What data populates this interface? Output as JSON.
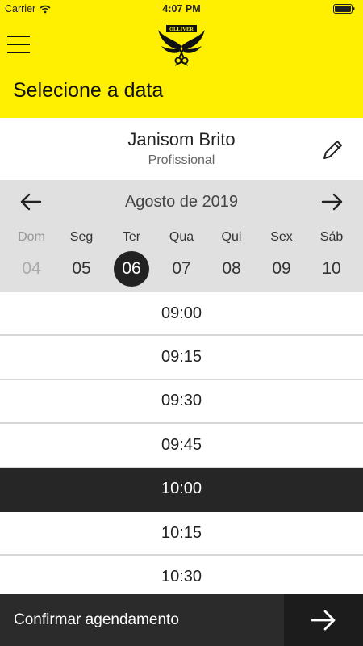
{
  "status_bar": {
    "carrier": "Carrier",
    "time": "4:07 PM"
  },
  "header": {
    "title": "Selecione a data",
    "logo_text": "OLLIVER"
  },
  "professional": {
    "name": "Janisom Brito",
    "role": "Profissional"
  },
  "calendar": {
    "month_label": "Agosto de 2019",
    "weekdays": [
      "Dom",
      "Seg",
      "Ter",
      "Qua",
      "Qui",
      "Sex",
      "Sáb"
    ],
    "days": [
      "04",
      "05",
      "06",
      "07",
      "08",
      "09",
      "10"
    ],
    "selected_day": "06"
  },
  "time_slots": [
    "09:00",
    "09:15",
    "09:30",
    "09:45",
    "10:00",
    "10:15",
    "10:30"
  ],
  "selected_time": "10:00",
  "footer": {
    "confirm_label": "Confirmar agendamento"
  },
  "colors": {
    "accent": "#ffef00",
    "dark": "#262626",
    "calendar_bg": "#e0e0e0"
  },
  "icons": [
    "wifi-icon",
    "battery-icon",
    "menu-icon",
    "logo-icon",
    "edit-pencil-icon",
    "arrow-left-icon",
    "arrow-right-icon",
    "confirm-arrow-icon"
  ]
}
